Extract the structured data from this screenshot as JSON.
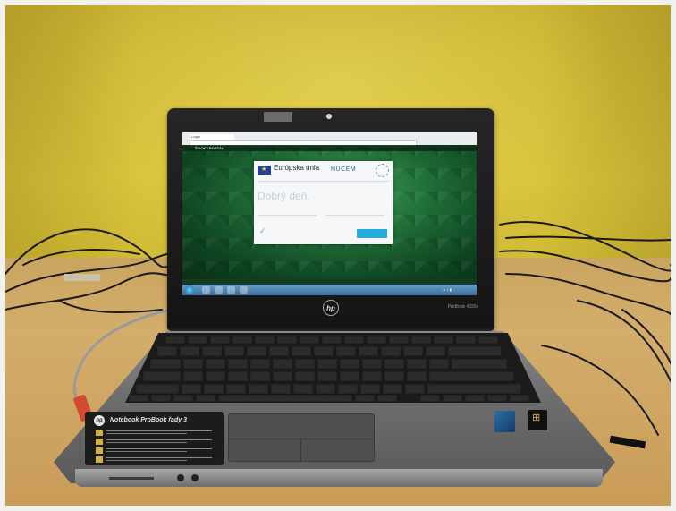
{
  "screen": {
    "browser_tab": "Login",
    "url": "",
    "portal_title": "ŽIACKY PORTÁL",
    "portal_header_right": "",
    "card": {
      "eu_title": "Európska únia",
      "eu_subtitle": "",
      "nucem_logo": "NUCEM",
      "greeting": "Dobrý deň,",
      "user_field_label": "",
      "password_field_label": "",
      "login_button": ""
    },
    "taskbar_clock": ""
  },
  "laptop": {
    "brand_logo": "hp",
    "model_label": "ProBook 4330s",
    "sticker_title": "Notebook ProBook řady 3",
    "badges": [
      "intel-core-i5-badge",
      "windows-7-badge"
    ]
  },
  "colors": {
    "wall": "#d6c13a",
    "desk": "#d0a866",
    "laptop_body": "#6f6f6f",
    "screen_green": "#1e6b36",
    "login_button": "#27a9e1",
    "taskbar": "#4f83ad"
  }
}
